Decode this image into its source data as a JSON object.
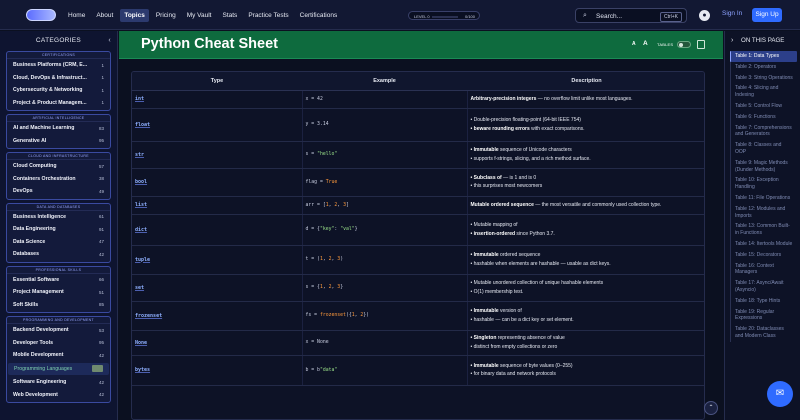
{
  "topbar": {
    "nav": [
      "Home",
      "About",
      "Topics",
      "Pricing",
      "My Vault",
      "Stats",
      "Practice Tests",
      "Certifications"
    ],
    "active_nav": "Topics",
    "level_label": "LEVEL 0",
    "level_progress": 0,
    "xp": "0/100",
    "search_placeholder": "Search...",
    "search_shortcut": "Ctrl+K",
    "signin": "Sign In",
    "signup": "Sign Up"
  },
  "sidebar": {
    "title": "CATEGORIES",
    "groups": [
      {
        "title": "CERTIFICATIONS",
        "items": [
          {
            "label": "Business Platforms (CRM, E...",
            "count": "1"
          },
          {
            "label": "Cloud, DevOps & Infrastruct...",
            "count": "1"
          },
          {
            "label": "Cybersecurity & Networking",
            "count": "1"
          },
          {
            "label": "Project & Product Managem...",
            "count": "1"
          }
        ]
      },
      {
        "title": "ARTIFICIAL INTELLIGENCE",
        "items": [
          {
            "label": "AI and Machine Learning",
            "count": "83"
          },
          {
            "label": "Generative AI",
            "count": "95"
          }
        ]
      },
      {
        "title": "CLOUD AND INFRASTRUCTURE",
        "items": [
          {
            "label": "Cloud Computing",
            "count": "57"
          },
          {
            "label": "Containers Orchestration",
            "count": "38"
          },
          {
            "label": "DevOps",
            "count": "49"
          }
        ]
      },
      {
        "title": "DATA AND DATABASES",
        "items": [
          {
            "label": "Business Intelligence",
            "count": "61"
          },
          {
            "label": "Data Engineering",
            "count": "91"
          },
          {
            "label": "Data Science",
            "count": "47"
          },
          {
            "label": "Databases",
            "count": "42"
          }
        ]
      },
      {
        "title": "PROFESSIONAL SKILLS",
        "items": [
          {
            "label": "Essential Software",
            "count": "66"
          },
          {
            "label": "Project Management",
            "count": "51"
          },
          {
            "label": "Soft Skills",
            "count": "85"
          }
        ]
      },
      {
        "title": "PROGRAMMING AND DEVELOPMENT",
        "items": [
          {
            "label": "Backend Development",
            "count": "53"
          },
          {
            "label": "Developer Tools",
            "count": "95"
          },
          {
            "label": "Mobile Development",
            "count": "42"
          },
          {
            "label": "Programming Languages",
            "count": "",
            "selected": true
          },
          {
            "label": "Software Engineering",
            "count": "42"
          },
          {
            "label": "Web Development",
            "count": "42"
          }
        ]
      }
    ]
  },
  "main": {
    "title": "Python Cheat Sheet",
    "font_small": "A",
    "font_large": "A",
    "tables_label": "TABLES",
    "columns": [
      "Type",
      "Example",
      "Description"
    ],
    "rows": [
      {
        "type": "int",
        "example": [
          {
            "t": "x = 42",
            "c": ""
          }
        ],
        "desc": [
          {
            "b": "Arbitrary-precision integers",
            "r": " — no overflow limit unlike most languages."
          }
        ]
      },
      {
        "type": "float",
        "example": [
          {
            "t": "y = 3.14",
            "c": ""
          }
        ],
        "desc": [
          {
            "b": "",
            "r": "• Double-precision floating-point (64-bit IEEE 754)"
          },
          {
            "b": "• beware rounding errors",
            "r": " with exact comparisons."
          }
        ]
      },
      {
        "type": "str",
        "example": [
          {
            "t": "s = ",
            "c": ""
          },
          {
            "t": "\"hello\"",
            "c": "str"
          }
        ],
        "desc": [
          {
            "b": "• Immutable",
            "r": " sequence of Unicode characters"
          },
          {
            "b": "",
            "r": "• supports f-strings, slicing, and a rich method surface."
          }
        ]
      },
      {
        "type": "bool",
        "example": [
          {
            "t": "flag = ",
            "c": ""
          },
          {
            "t": "True",
            "c": "kw"
          }
        ],
        "desc": [
          {
            "b": "• Subclass of",
            "r": "      —       is 1 and          is 0"
          },
          {
            "b": "",
            "r": "• this surprises most newcomers"
          }
        ]
      },
      {
        "type": "list",
        "example": [
          {
            "t": "arr = [",
            "c": ""
          },
          {
            "t": "1",
            "c": "kw"
          },
          {
            "t": ", ",
            "c": ""
          },
          {
            "t": "2",
            "c": "kw"
          },
          {
            "t": ", ",
            "c": ""
          },
          {
            "t": "3",
            "c": "kw"
          },
          {
            "t": "]",
            "c": ""
          }
        ],
        "desc": [
          {
            "b": "Mutable ordered sequence",
            "r": " — the most versatile and commonly used collection type."
          }
        ]
      },
      {
        "type": "dict",
        "example": [
          {
            "t": "d = {",
            "c": ""
          },
          {
            "t": "\"key\"",
            "c": "str"
          },
          {
            "t": ": ",
            "c": ""
          },
          {
            "t": "\"val\"",
            "c": "str"
          },
          {
            "t": "}",
            "c": ""
          }
        ],
        "desc": [
          {
            "b": "",
            "r": "• Mutable mapping of "
          },
          {
            "b": "• insertion-ordered",
            "r": " since Python 3.7."
          }
        ]
      },
      {
        "type": "tuple",
        "example": [
          {
            "t": "t = (",
            "c": ""
          },
          {
            "t": "1",
            "c": "kw"
          },
          {
            "t": ", ",
            "c": ""
          },
          {
            "t": "2",
            "c": "kw"
          },
          {
            "t": ", ",
            "c": ""
          },
          {
            "t": "3",
            "c": "kw"
          },
          {
            "t": ")",
            "c": ""
          }
        ],
        "desc": [
          {
            "b": "• Immutable",
            "r": " ordered sequence"
          },
          {
            "b": "",
            "r": "• hashable when elements are hashable — usable as dict keys."
          }
        ]
      },
      {
        "type": "set",
        "example": [
          {
            "t": "s = {",
            "c": ""
          },
          {
            "t": "1",
            "c": "kw"
          },
          {
            "t": ", ",
            "c": ""
          },
          {
            "t": "2",
            "c": "kw"
          },
          {
            "t": ", ",
            "c": ""
          },
          {
            "t": "3",
            "c": "kw"
          },
          {
            "t": "}",
            "c": ""
          }
        ],
        "desc": [
          {
            "b": "",
            "r": "• Mutable unordered collection of unique hashable elements"
          },
          {
            "b": "",
            "r": "• O(1) membership test."
          }
        ]
      },
      {
        "type": "frozenset",
        "example": [
          {
            "t": "fs = ",
            "c": ""
          },
          {
            "t": "frozenset",
            "c": "kw"
          },
          {
            "t": "({",
            "c": ""
          },
          {
            "t": "1",
            "c": "kw"
          },
          {
            "t": ", ",
            "c": ""
          },
          {
            "t": "2",
            "c": "kw"
          },
          {
            "t": "})",
            "c": ""
          }
        ],
        "desc": [
          {
            "b": "• Immutable",
            "r": " version of"
          },
          {
            "b": "",
            "r": "• hashable — can be a dict key or set element."
          }
        ]
      },
      {
        "type": "None",
        "example": [
          {
            "t": "x = None",
            "c": ""
          }
        ],
        "desc": [
          {
            "b": "• Singleton",
            "r": " representing absence of value"
          },
          {
            "b": "",
            "r": "• distinct from empty collections or zero"
          }
        ]
      },
      {
        "type": "bytes",
        "example": [
          {
            "t": "b = b",
            "c": ""
          },
          {
            "t": "\"data\"",
            "c": "str"
          }
        ],
        "desc": [
          {
            "b": "• Immutable",
            "r": " sequence of byte values (0–255)"
          },
          {
            "b": "",
            "r": "• for binary data and network protocols"
          }
        ]
      }
    ]
  },
  "onpage": {
    "title": "ON THIS PAGE",
    "items": [
      "Table 1: Data Types",
      "Table 2: Operators",
      "Table 3: String Operations",
      "Table 4: Slicing and Indexing",
      "Table 5: Control Flow",
      "Table 6: Functions",
      "Table 7: Comprehensions and Generators",
      "Table 8: Classes and OOP",
      "Table 9: Magic Methods (Dunder Methods)",
      "Table 10: Exception Handling",
      "Table 11: File Operations",
      "Table 12: Modules and Imports",
      "Table 13: Common Built-in Functions",
      "Table 14: Itertools Module",
      "Table 15: Decorators",
      "Table 16: Context Managers",
      "Table 17: Async/Await (Asyncio)",
      "Table 18: Type Hints",
      "Table 19: Regular Expressions",
      "Table 20: Dataclasses and Modern Class"
    ],
    "active_index": 0
  },
  "icons": {
    "search": "search-icon",
    "github": "github-icon",
    "chat": "chat-icon",
    "scroll_top": "arrow-up-icon"
  },
  "colors": {
    "accent": "#2f6bff",
    "hero": "#0e6b3e",
    "keyword": "#ff9a3c",
    "string": "#9be38a"
  }
}
